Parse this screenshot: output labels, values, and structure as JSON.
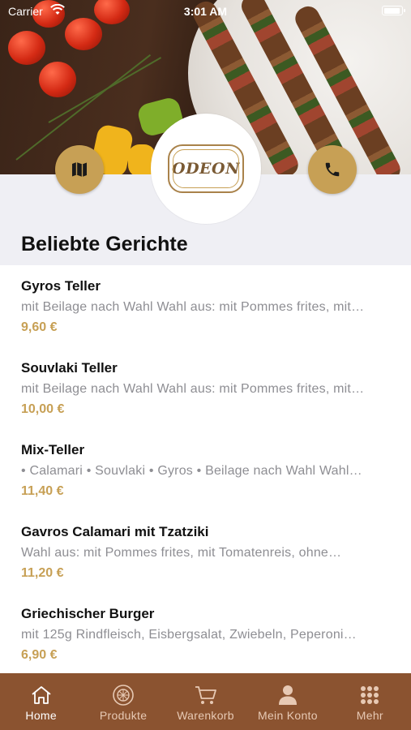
{
  "status_bar": {
    "carrier": "Carrier",
    "time": "3:01 AM"
  },
  "logo": {
    "text": "ODEON"
  },
  "section_title": "Beliebte Gerichte",
  "items": [
    {
      "name": "Gyros Teller",
      "description": "mit Beilage nach Wahl Wahl aus: mit Pommes frites, mit…",
      "price": "9,60 €"
    },
    {
      "name": "Souvlaki Teller",
      "description": "mit Beilage nach Wahl Wahl aus: mit Pommes frites, mit…",
      "price": "10,00 €"
    },
    {
      "name": "Mix-Teller",
      "description": "• Calamari • Souvlaki • Gyros • Beilage nach Wahl Wahl…",
      "price": "11,40 €"
    },
    {
      "name": "Gavros Calamari mit Tzatziki",
      "description": "Wahl aus: mit Pommes frites, mit Tomatenreis, ohne…",
      "price": "11,20 €"
    },
    {
      "name": "Griechischer Burger",
      "description": "mit 125g Rindfleisch, Eisbergsalat, Zwiebeln, Peperoni…",
      "price": "6,90 €"
    }
  ],
  "tabbar": {
    "tabs": [
      {
        "label": "Home",
        "icon": "home-icon",
        "active": true
      },
      {
        "label": "Produkte",
        "icon": "plate-icon",
        "active": false
      },
      {
        "label": "Warenkorb",
        "icon": "cart-icon",
        "active": false
      },
      {
        "label": "Mein Konto",
        "icon": "person-icon",
        "active": false
      },
      {
        "label": "Mehr",
        "icon": "grid-icon",
        "active": false
      }
    ]
  },
  "colors": {
    "accent": "#c7a055",
    "tabbar": "#8b5330",
    "tab_label": "#e7c9b4",
    "background": "#efeff4"
  }
}
